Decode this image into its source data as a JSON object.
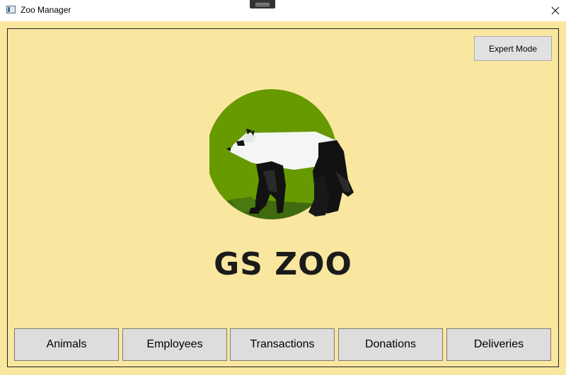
{
  "window": {
    "title": "Zoo Manager",
    "icons": {
      "app": "app-window-icon",
      "close": "close-icon"
    }
  },
  "header": {
    "expert_mode_label": "Expert Mode"
  },
  "logo": {
    "brand_text": "GS ZOO",
    "image": "panda-logo"
  },
  "nav": {
    "items": [
      {
        "label": "Animals"
      },
      {
        "label": "Employees"
      },
      {
        "label": "Transactions"
      },
      {
        "label": "Donations"
      },
      {
        "label": "Deliveries"
      }
    ]
  },
  "colors": {
    "background": "#f9e79f",
    "button_face": "#dddddd",
    "logo_circle": "#669a00",
    "logo_ground": "#3f6a0d",
    "brand_text": "#1b1b1b"
  }
}
